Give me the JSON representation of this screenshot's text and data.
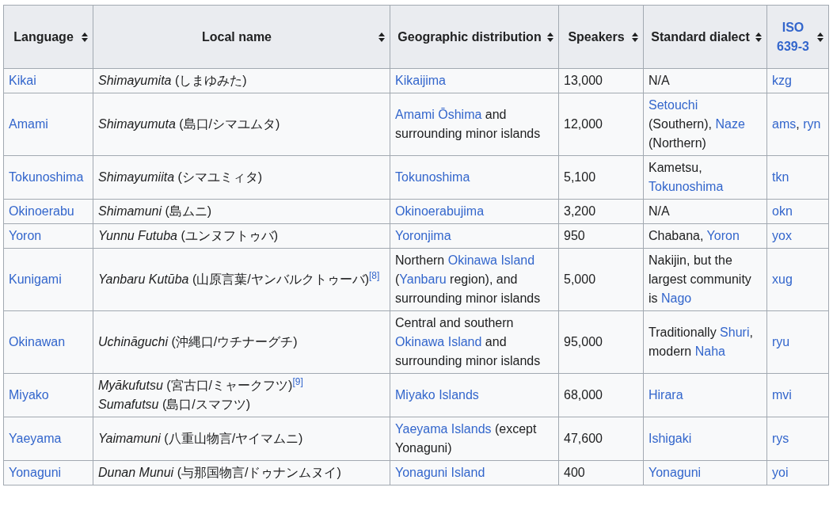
{
  "table": {
    "columns": [
      {
        "label": "Language",
        "link": false
      },
      {
        "label": "Local name",
        "link": false
      },
      {
        "label": "Geographic distribution",
        "link": false
      },
      {
        "label": "Speakers",
        "link": false
      },
      {
        "label": "Standard dialect",
        "link": false
      },
      {
        "label": "ISO 639-3",
        "link": true
      }
    ],
    "rows": [
      {
        "language": "Kikai",
        "local_names": [
          {
            "name": "Shimayumita",
            "gloss": "(しまゆみた)"
          }
        ],
        "distribution": [
          {
            "text": "Kikaijima",
            "link": true
          }
        ],
        "speakers": "13,000",
        "dialect": [
          {
            "text": "N/A",
            "link": false
          }
        ],
        "iso": [
          {
            "text": "kzg",
            "link": true
          }
        ]
      },
      {
        "language": "Amami",
        "local_names": [
          {
            "name": "Shimayumuta",
            "gloss": "(島口/シマユムタ)"
          }
        ],
        "distribution": [
          {
            "text": "Amami Ōshima",
            "link": true
          },
          {
            "text": " and surrounding minor islands",
            "link": false
          }
        ],
        "speakers": "12,000",
        "dialect": [
          {
            "text": "Setouchi",
            "link": true
          },
          {
            "text": " (Southern), ",
            "link": false
          },
          {
            "text": "Naze",
            "link": true
          },
          {
            "text": " (Northern)",
            "link": false
          }
        ],
        "iso": [
          {
            "text": "ams",
            "link": true
          },
          {
            "text": ", ",
            "link": false
          },
          {
            "text": "ryn",
            "link": true
          }
        ]
      },
      {
        "language": "Tokunoshima",
        "local_names": [
          {
            "name": "Shimayumiita",
            "gloss": "(シマユミィタ)"
          }
        ],
        "distribution": [
          {
            "text": "Tokunoshima",
            "link": true
          }
        ],
        "speakers": "5,100",
        "dialect": [
          {
            "text": "Kametsu, ",
            "link": false
          },
          {
            "text": "Tokunoshima",
            "link": true
          }
        ],
        "iso": [
          {
            "text": "tkn",
            "link": true
          }
        ]
      },
      {
        "language": "Okinoerabu",
        "local_names": [
          {
            "name": "Shimamuni",
            "gloss": "(島ムニ)"
          }
        ],
        "distribution": [
          {
            "text": "Okinoerabujima",
            "link": true
          }
        ],
        "speakers": "3,200",
        "dialect": [
          {
            "text": "N/A",
            "link": false
          }
        ],
        "iso": [
          {
            "text": "okn",
            "link": true
          }
        ]
      },
      {
        "language": "Yoron",
        "local_names": [
          {
            "name": "Yunnu Futuba",
            "gloss": "(ユンヌフトゥバ)"
          }
        ],
        "distribution": [
          {
            "text": "Yoronjima",
            "link": true
          }
        ],
        "speakers": "950",
        "dialect": [
          {
            "text": "Chabana, ",
            "link": false
          },
          {
            "text": "Yoron",
            "link": true
          }
        ],
        "iso": [
          {
            "text": "yox",
            "link": true
          }
        ]
      },
      {
        "language": "Kunigami",
        "local_names": [
          {
            "name": "Yanbaru Kutūba",
            "gloss": "(山原言葉/ヤンバルクトゥーバ)",
            "ref": "[8]"
          }
        ],
        "distribution": [
          {
            "text": "Northern ",
            "link": false
          },
          {
            "text": "Okinawa Island",
            "link": true
          },
          {
            "text": " (",
            "link": false
          },
          {
            "text": "Yanbaru",
            "link": true
          },
          {
            "text": " region), and surrounding minor islands",
            "link": false
          }
        ],
        "speakers": "5,000",
        "dialect": [
          {
            "text": "Nakijin, but the largest community is ",
            "link": false
          },
          {
            "text": "Nago",
            "link": true
          }
        ],
        "iso": [
          {
            "text": "xug",
            "link": true
          }
        ]
      },
      {
        "language": "Okinawan",
        "local_names": [
          {
            "name": "Uchināguchi",
            "gloss": "(沖縄口/ウチナーグチ)"
          }
        ],
        "distribution": [
          {
            "text": "Central and southern ",
            "link": false
          },
          {
            "text": "Okinawa Island",
            "link": true
          },
          {
            "text": " and surrounding minor islands",
            "link": false
          }
        ],
        "speakers": "95,000",
        "dialect": [
          {
            "text": "Traditionally ",
            "link": false
          },
          {
            "text": "Shuri",
            "link": true
          },
          {
            "text": ", modern ",
            "link": false
          },
          {
            "text": "Naha",
            "link": true
          }
        ],
        "iso": [
          {
            "text": "ryu",
            "link": true
          }
        ]
      },
      {
        "language": "Miyako",
        "local_names": [
          {
            "name": "Myākufutsu",
            "gloss": "(宮古口/ミャークフツ)",
            "ref": "[9]"
          },
          {
            "name": "Sumafutsu",
            "gloss": "(島口/スマフツ)"
          }
        ],
        "distribution": [
          {
            "text": "Miyako Islands",
            "link": true
          }
        ],
        "speakers": "68,000",
        "dialect": [
          {
            "text": "Hirara",
            "link": true
          }
        ],
        "iso": [
          {
            "text": "mvi",
            "link": true
          }
        ]
      },
      {
        "language": "Yaeyama",
        "local_names": [
          {
            "name": "Yaimamuni",
            "gloss": "(八重山物言/ヤイマムニ)"
          }
        ],
        "distribution": [
          {
            "text": "Yaeyama Islands",
            "link": true
          },
          {
            "text": " (except Yonaguni)",
            "link": false
          }
        ],
        "speakers": "47,600",
        "dialect": [
          {
            "text": "Ishigaki",
            "link": true
          }
        ],
        "iso": [
          {
            "text": "rys",
            "link": true
          }
        ]
      },
      {
        "language": "Yonaguni",
        "local_names": [
          {
            "name": "Dunan Munui",
            "gloss": "(与那国物言/ドゥナンムヌイ)"
          }
        ],
        "distribution": [
          {
            "text": "Yonaguni Island",
            "link": true
          }
        ],
        "speakers": "400",
        "dialect": [
          {
            "text": "Yonaguni",
            "link": true
          }
        ],
        "iso": [
          {
            "text": "yoi",
            "link": true
          }
        ]
      }
    ]
  }
}
